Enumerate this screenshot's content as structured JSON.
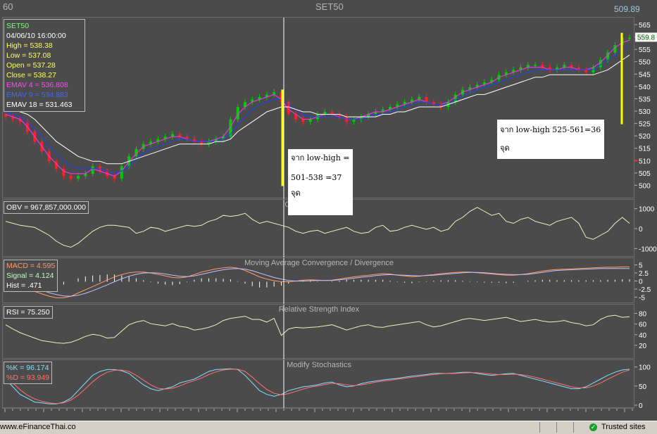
{
  "window": {
    "left_label": "60",
    "title": "SET50",
    "last_price": "509.89"
  },
  "info_box": {
    "symbol": "SET50",
    "datetime": "04/06/10 16:00:00",
    "high": "High  = 538.38",
    "low": "Low   = 537.08",
    "open": "Open  = 537.28",
    "close": "Close = 538.27",
    "ema4": "EMAV 4 = 536.808",
    "ema9": "EMAV 9 = 534.883",
    "ema18": "EMAV 18 = 531.463"
  },
  "annotations": {
    "note1_line1": "จาก low-high =",
    "note1_line2": "501-538 =37  จุด",
    "note2": "จาก low-high 525-561=36 จุด",
    "price_tag": "559.8"
  },
  "indicator_labels": {
    "obv_title": "On Balance Volume",
    "obv_value": "OBV = 967,857,000.000",
    "macd_title": "Moving Average Convergence / Divergence",
    "macd": "MACD = 4.595",
    "signal": "Signal = 4.124",
    "hist": "Hist = .471",
    "rsi_title": "Relative Strength Index",
    "rsi": "RSI = 75.250",
    "stoch_title": "Modify Stochastics",
    "k": "%K = 96.174",
    "d": "%D = 93.949"
  },
  "status": {
    "left": "www.eFinanceThai.co",
    "right": "Trusted sites"
  },
  "colors": {
    "bull": "#00cc00",
    "bear": "#ff2020",
    "ema4": "#ff33ff",
    "ema9": "#2040ff",
    "ema18": "#ffffff",
    "obv": "#f0f0c0",
    "macd": "#ff9966",
    "signal": "#c0c0ff",
    "hist": "#ffffff",
    "rsi": "#f0f0c0",
    "k": "#80e0ff",
    "d": "#ff7070",
    "marker": "#ffff00",
    "highlight": "#ff3030"
  },
  "chart_data": [
    {
      "type": "candlestick",
      "title": "SET50",
      "y_ticks": [
        500,
        505,
        510,
        515,
        520,
        525,
        530,
        535,
        540,
        545,
        550,
        555,
        560,
        565
      ],
      "highlight_level": 510,
      "ylim": [
        497,
        567
      ],
      "last_close": 538.27,
      "series": [
        {
          "name": "Price",
          "values": [
            528,
            527,
            526,
            522,
            518,
            514,
            510,
            507,
            504,
            503,
            504,
            505,
            508,
            506,
            504,
            503,
            508,
            512,
            515,
            517,
            518,
            519,
            520,
            521,
            520,
            519,
            518,
            517,
            518,
            519,
            520,
            527,
            532,
            534,
            535,
            536,
            537,
            538,
            534,
            529,
            527,
            526,
            527,
            529,
            530,
            529,
            528,
            526,
            527,
            528,
            529,
            530,
            531,
            532,
            533,
            534,
            535,
            536,
            534,
            533,
            532,
            534,
            537,
            539,
            540,
            541,
            542,
            543,
            545,
            546,
            547,
            548,
            549,
            549,
            548,
            547,
            548,
            549,
            548,
            547,
            546,
            548,
            551,
            554,
            557,
            560,
            560
          ]
        },
        {
          "name": "EMAV 4",
          "values": [
            529,
            528,
            527,
            524,
            520,
            516,
            512,
            509,
            506,
            505,
            505,
            505,
            507,
            506,
            505,
            504,
            506,
            510,
            513,
            516,
            517,
            518,
            519,
            520,
            520,
            519,
            518,
            518,
            518,
            519,
            520,
            524,
            529,
            532,
            534,
            535,
            536,
            537,
            535,
            531,
            529,
            527,
            527,
            528,
            529,
            529,
            528,
            527,
            527,
            528,
            529,
            530,
            530,
            531,
            532,
            533,
            534,
            535,
            534,
            533,
            533,
            534,
            536,
            538,
            539,
            540,
            541,
            542,
            544,
            545,
            546,
            547,
            548,
            548,
            548,
            547,
            547,
            548,
            548,
            547,
            547,
            548,
            550,
            553,
            556,
            558,
            559
          ]
        },
        {
          "name": "EMAV 9",
          "values": [
            530,
            529,
            528,
            526,
            523,
            520,
            516,
            513,
            510,
            508,
            507,
            507,
            507,
            507,
            506,
            505,
            506,
            508,
            511,
            513,
            515,
            516,
            517,
            518,
            519,
            519,
            518,
            518,
            518,
            518,
            519,
            521,
            525,
            528,
            531,
            533,
            534,
            535,
            535,
            533,
            531,
            529,
            528,
            528,
            528,
            528,
            528,
            527,
            527,
            527,
            528,
            529,
            529,
            530,
            531,
            532,
            533,
            534,
            534,
            533,
            533,
            533,
            535,
            536,
            538,
            539,
            540,
            541,
            542,
            543,
            544,
            545,
            546,
            547,
            547,
            547,
            547,
            547,
            547,
            547,
            547,
            547,
            549,
            551,
            553,
            555,
            557
          ]
        },
        {
          "name": "EMAV 18",
          "values": [
            531,
            531,
            530,
            529,
            527,
            524,
            521,
            518,
            516,
            514,
            512,
            511,
            510,
            510,
            509,
            509,
            509,
            510,
            511,
            512,
            513,
            514,
            515,
            516,
            517,
            517,
            517,
            517,
            517,
            518,
            518,
            519,
            522,
            524,
            526,
            528,
            530,
            531,
            532,
            532,
            531,
            530,
            530,
            529,
            529,
            529,
            529,
            528,
            528,
            528,
            528,
            528,
            529,
            529,
            530,
            530,
            531,
            532,
            532,
            532,
            532,
            533,
            534,
            535,
            536,
            537,
            537,
            538,
            539,
            540,
            541,
            542,
            543,
            544,
            544,
            545,
            545,
            545,
            545,
            545,
            545,
            545,
            546,
            547,
            549,
            551,
            553
          ]
        }
      ]
    },
    {
      "type": "line",
      "title": "On Balance Volume",
      "y_ticks": [
        "1000",
        "0",
        "-1000"
      ],
      "ylim": [
        -1200,
        1200
      ],
      "series": [
        {
          "name": "OBV",
          "values": [
            400,
            300,
            200,
            150,
            100,
            -100,
            -300,
            -600,
            -800,
            -900,
            -700,
            -400,
            -100,
            100,
            200,
            200,
            150,
            100,
            -200,
            -100,
            100,
            50,
            -100,
            0,
            100,
            200,
            150,
            200,
            400,
            500,
            700,
            650,
            700,
            800,
            500,
            300,
            400,
            300,
            200,
            100,
            -100,
            -200,
            -100,
            -50,
            -200,
            -100,
            0,
            100,
            -100,
            -200,
            -150,
            100,
            200,
            -100,
            -50,
            100,
            200,
            100,
            0,
            100,
            -100,
            0,
            400,
            600,
            900,
            1100,
            900,
            700,
            800,
            400,
            300,
            500,
            600,
            400,
            300,
            200,
            400,
            500,
            600,
            300,
            -400,
            -500,
            -300,
            -100,
            300,
            600,
            300
          ]
        }
      ]
    },
    {
      "type": "line",
      "title": "Moving Average Convergence / Divergence",
      "y_ticks": [
        "5",
        "2.5",
        "0",
        "-2.5",
        "-5"
      ],
      "ylim": [
        -6,
        6
      ],
      "series": [
        {
          "name": "MACD",
          "values": [
            0,
            -0.5,
            -1.2,
            -2,
            -3,
            -3.8,
            -4.5,
            -5,
            -5,
            -4.5,
            -3.5,
            -2.5,
            -1.5,
            -0.5,
            0.5,
            1.5,
            2.2,
            2.8,
            3,
            3,
            2.7,
            2.3,
            1.8,
            1.3,
            1.2,
            1.5,
            2.2,
            3,
            3.5,
            4,
            4.3,
            4.5,
            4.2,
            3.5,
            2.5,
            1.5,
            0.8,
            0.3,
            0,
            0,
            0.2,
            0.5,
            0.6,
            0.5,
            0.4,
            0.5,
            0.8,
            1.2,
            1.5,
            1.8,
            2,
            2.3,
            2.5,
            2.4,
            2,
            1.8,
            1.6,
            1.7,
            2,
            2.2,
            2.5,
            2.7,
            2.9,
            3,
            3,
            2.8,
            2.6,
            2.4,
            2.2,
            2,
            2,
            2.2,
            2.5,
            2.9,
            3.3,
            3.6,
            3.8,
            3.9,
            4,
            4.1,
            4.2,
            4.3,
            4.4,
            4.5,
            4.5,
            4.6,
            4.6
          ]
        },
        {
          "name": "Signal",
          "values": [
            0.5,
            0.2,
            -0.3,
            -1,
            -1.8,
            -2.6,
            -3.4,
            -4,
            -4.4,
            -4.5,
            -4.2,
            -3.6,
            -2.8,
            -1.9,
            -1,
            0,
            0.9,
            1.7,
            2.3,
            2.7,
            2.8,
            2.7,
            2.4,
            2,
            1.7,
            1.6,
            1.8,
            2.3,
            2.8,
            3.3,
            3.7,
            4,
            4.1,
            3.9,
            3.4,
            2.7,
            2,
            1.3,
            0.8,
            0.4,
            0.2,
            0.2,
            0.3,
            0.4,
            0.4,
            0.4,
            0.6,
            0.8,
            1.1,
            1.4,
            1.6,
            1.9,
            2.1,
            2.2,
            2.1,
            2,
            1.9,
            1.8,
            1.9,
            2,
            2.2,
            2.4,
            2.6,
            2.8,
            2.9,
            2.9,
            2.8,
            2.6,
            2.4,
            2.3,
            2.2,
            2.2,
            2.3,
            2.6,
            2.9,
            3.2,
            3.5,
            3.6,
            3.7,
            3.8,
            3.9,
            4,
            4.1,
            4.1,
            4.1,
            4.1,
            4.1
          ]
        }
      ]
    },
    {
      "type": "line",
      "title": "Relative Strength Index",
      "y_ticks": [
        "80",
        "60",
        "40",
        "20"
      ],
      "ylim": [
        0,
        90
      ],
      "series": [
        {
          "name": "RSI",
          "values": [
            60,
            52,
            45,
            40,
            35,
            30,
            28,
            26,
            25,
            27,
            32,
            38,
            42,
            40,
            35,
            36,
            48,
            60,
            65,
            68,
            62,
            60,
            58,
            62,
            57,
            55,
            50,
            52,
            55,
            60,
            68,
            72,
            74,
            76,
            70,
            70,
            65,
            72,
            40,
            52,
            55,
            54,
            55,
            56,
            58,
            60,
            55,
            50,
            54,
            58,
            60,
            56,
            55,
            58,
            60,
            62,
            64,
            66,
            60,
            56,
            58,
            62,
            66,
            70,
            72,
            70,
            68,
            70,
            72,
            74,
            70,
            66,
            68,
            70,
            67,
            65,
            66,
            68,
            64,
            62,
            58,
            60,
            70,
            76,
            78,
            74,
            75
          ]
        }
      ]
    },
    {
      "type": "line",
      "title": "Modify Stochastics",
      "y_ticks": [
        "100",
        "50",
        "0"
      ],
      "ylim": [
        0,
        105
      ],
      "series": [
        {
          "name": "%K",
          "values": [
            70,
            50,
            30,
            20,
            10,
            8,
            5,
            5,
            10,
            20,
            40,
            60,
            80,
            90,
            95,
            95,
            92,
            85,
            70,
            55,
            45,
            40,
            45,
            50,
            60,
            65,
            70,
            80,
            90,
            95,
            96,
            97,
            95,
            80,
            60,
            40,
            30,
            25,
            30,
            40,
            45,
            50,
            52,
            55,
            60,
            62,
            55,
            50,
            52,
            58,
            62,
            65,
            68,
            70,
            72,
            75,
            78,
            80,
            82,
            85,
            85,
            85,
            86,
            88,
            88,
            85,
            82,
            80,
            82,
            84,
            85,
            80,
            75,
            70,
            65,
            60,
            55,
            50,
            45,
            45,
            50,
            60,
            70,
            80,
            88,
            94,
            96
          ]
        },
        {
          "name": "%D",
          "values": [
            75,
            60,
            42,
            28,
            18,
            12,
            8,
            6,
            8,
            15,
            28,
            45,
            63,
            78,
            88,
            93,
            94,
            90,
            80,
            67,
            55,
            46,
            44,
            46,
            52,
            60,
            66,
            73,
            82,
            89,
            94,
            96,
            96,
            90,
            75,
            58,
            43,
            33,
            29,
            32,
            38,
            44,
            49,
            52,
            56,
            59,
            58,
            55,
            53,
            55,
            58,
            62,
            65,
            67,
            70,
            72,
            75,
            77,
            80,
            82,
            84,
            85,
            85,
            86,
            87,
            87,
            85,
            83,
            82,
            82,
            83,
            82,
            79,
            75,
            70,
            65,
            60,
            55,
            50,
            47,
            47,
            52,
            60,
            70,
            79,
            88,
            94
          ]
        }
      ]
    }
  ]
}
